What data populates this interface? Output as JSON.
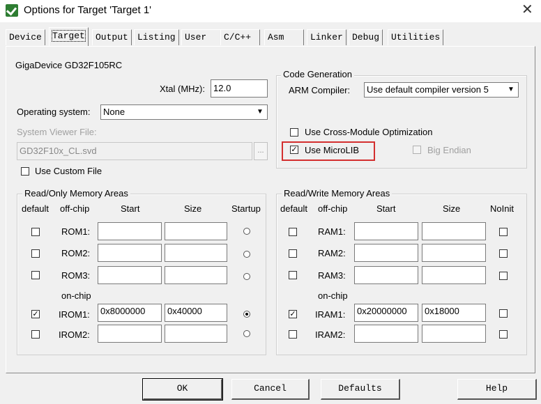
{
  "window": {
    "title": "Options for Target 'Target 1'",
    "icon": "keil-logo-icon"
  },
  "tabs": [
    {
      "label": "Device"
    },
    {
      "label": "Target"
    },
    {
      "label": "Output"
    },
    {
      "label": "Listing"
    },
    {
      "label": "User"
    },
    {
      "label": "C/C++"
    },
    {
      "label": "Asm"
    },
    {
      "label": "Linker"
    },
    {
      "label": "Debug"
    },
    {
      "label": "Utilities"
    }
  ],
  "target": {
    "device_name": "GigaDevice GD32F105RC",
    "xtal_label": "Xtal (MHz):",
    "xtal_value": "12.0",
    "os_label": "Operating system:",
    "os_value": "None",
    "svd_label": "System Viewer File:",
    "svd_value": "GD32F10x_CL.svd",
    "svd_browse": "...",
    "custom_file_label": "Use Custom File",
    "custom_file_checked": false
  },
  "code_gen": {
    "title": "Code Generation",
    "compiler_label": "ARM Compiler:",
    "compiler_value": "Use default compiler version 5",
    "cross_module_label": "Use Cross-Module Optimization",
    "cross_module_checked": false,
    "microlib_label": "Use MicroLIB",
    "microlib_checked": true,
    "big_endian_label": "Big Endian",
    "big_endian_checked": false,
    "highlight_color": "#d32f2f"
  },
  "ro_memory": {
    "title": "Read/Only Memory Areas",
    "headers": {
      "default": "default",
      "offchip": "off-chip",
      "start": "Start",
      "size": "Size",
      "startup": "Startup"
    },
    "onchip_label": "on-chip",
    "rows": [
      {
        "label": "ROM1:",
        "default": false,
        "start": "",
        "size": "",
        "startup": false
      },
      {
        "label": "ROM2:",
        "default": false,
        "start": "",
        "size": "",
        "startup": false
      },
      {
        "label": "ROM3:",
        "default": false,
        "start": "",
        "size": "",
        "startup": false
      },
      {
        "label": "IROM1:",
        "default": true,
        "start": "0x8000000",
        "size": "0x40000",
        "startup": true
      },
      {
        "label": "IROM2:",
        "default": false,
        "start": "",
        "size": "",
        "startup": false
      }
    ]
  },
  "rw_memory": {
    "title": "Read/Write Memory Areas",
    "headers": {
      "default": "default",
      "offchip": "off-chip",
      "start": "Start",
      "size": "Size",
      "noinit": "NoInit"
    },
    "onchip_label": "on-chip",
    "rows": [
      {
        "label": "RAM1:",
        "default": false,
        "start": "",
        "size": "",
        "noinit": false
      },
      {
        "label": "RAM2:",
        "default": false,
        "start": "",
        "size": "",
        "noinit": false
      },
      {
        "label": "RAM3:",
        "default": false,
        "start": "",
        "size": "",
        "noinit": false
      },
      {
        "label": "IRAM1:",
        "default": true,
        "start": "0x20000000",
        "size": "0x18000",
        "noinit": false
      },
      {
        "label": "IRAM2:",
        "default": false,
        "start": "",
        "size": "",
        "noinit": false
      }
    ]
  },
  "buttons": {
    "ok": "OK",
    "cancel": "Cancel",
    "defaults": "Defaults",
    "help": "Help"
  }
}
